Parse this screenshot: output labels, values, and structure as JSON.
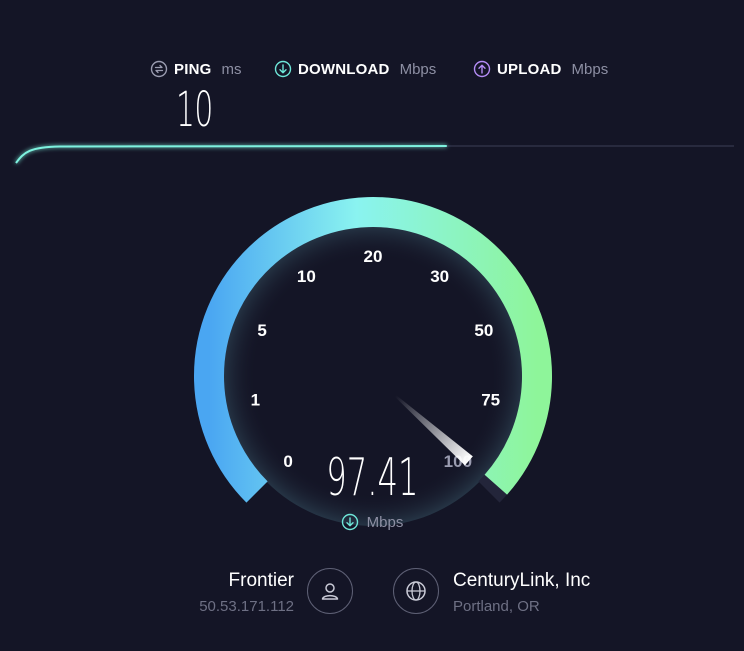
{
  "metrics": {
    "ping": {
      "label": "PING",
      "unit": "ms",
      "icon": "ping-icon"
    },
    "download": {
      "label": "DOWNLOAD",
      "unit": "Mbps",
      "icon": "download-icon"
    },
    "upload": {
      "label": "UPLOAD",
      "unit": "Mbps",
      "icon": "upload-icon"
    }
  },
  "ping_value": "10",
  "progress": {
    "fraction": 0.6
  },
  "gauge": {
    "ticks": [
      "0",
      "1",
      "5",
      "10",
      "20",
      "30",
      "50",
      "75",
      "100"
    ],
    "speed_value": "97.41",
    "speed_unit": "Mbps",
    "speed_icon": "download-icon",
    "needle_value": 97.41
  },
  "isp": {
    "name": "Frontier",
    "ip": "50.53.171.112",
    "icon": "user-icon"
  },
  "server": {
    "name": "CenturyLink, Inc",
    "location": "Portland, OR",
    "icon": "globe-icon"
  },
  "colors": {
    "background": "#141526",
    "gauge_start": "#4fb6f5",
    "gauge_mid": "#8af5e6",
    "gauge_end": "#8ef59a",
    "ping_accent": "#9a9cb0",
    "download_accent": "#6ee6d8",
    "upload_accent": "#b48cf5",
    "muted_text": "#8d8fa3"
  }
}
